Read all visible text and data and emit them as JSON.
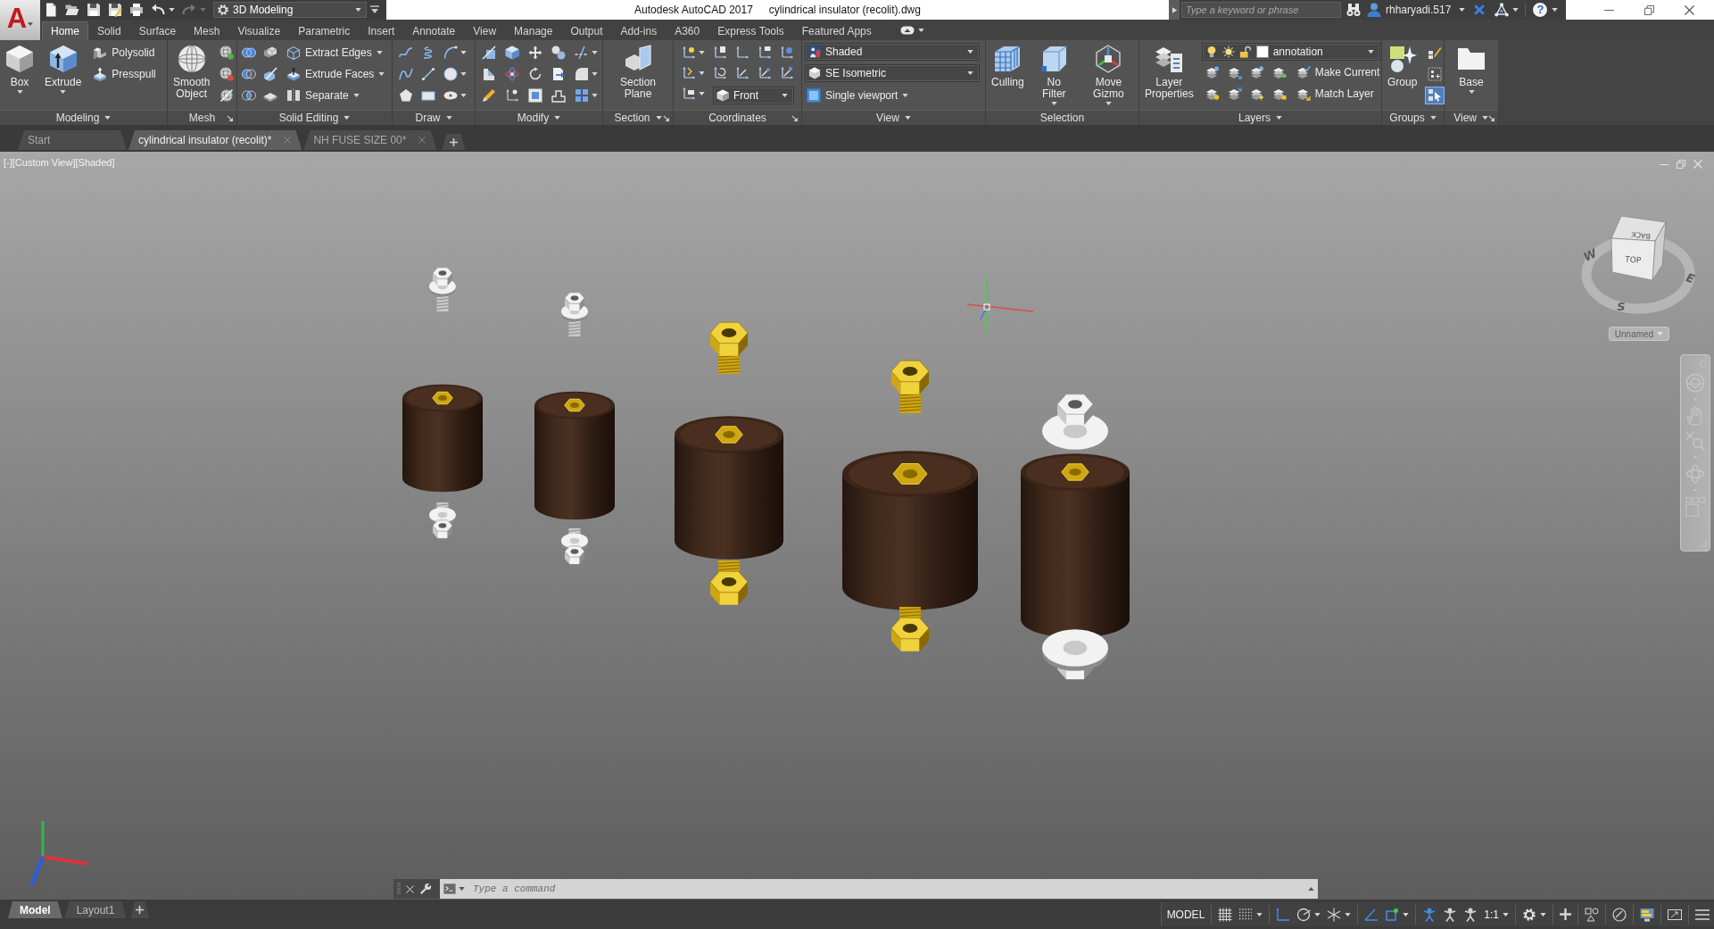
{
  "title_bar": {
    "app_logo": "A",
    "quick_access": [
      {
        "disabled": false
      },
      {
        "disabled": false
      },
      {
        "disabled": false
      },
      {
        "disabled": false
      },
      {
        "disabled": false
      },
      {
        "disabled": false
      },
      {
        "disabled": true
      }
    ],
    "workspace": "3D Modeling",
    "app_name": "Autodesk AutoCAD 2017",
    "file_name": "cylindrical insulator (recolit).dwg",
    "search": {
      "placeholder": "Type a keyword or phrase"
    },
    "user": "rhharyadi.517",
    "help": "?"
  },
  "ribbon_tabs": [
    {
      "label": "Home",
      "selected": true
    },
    {
      "label": "Solid",
      "selected": false
    },
    {
      "label": "Surface",
      "selected": false
    },
    {
      "label": "Mesh",
      "selected": false
    },
    {
      "label": "Visualize",
      "selected": false
    },
    {
      "label": "Parametric",
      "selected": false
    },
    {
      "label": "Insert",
      "selected": false
    },
    {
      "label": "Annotate",
      "selected": false
    },
    {
      "label": "View",
      "selected": false
    },
    {
      "label": "Manage",
      "selected": false
    },
    {
      "label": "Output",
      "selected": false
    },
    {
      "label": "Add-ins",
      "selected": false
    },
    {
      "label": "A360",
      "selected": false
    },
    {
      "label": "Express Tools",
      "selected": false
    },
    {
      "label": "Featured Apps",
      "selected": false
    }
  ],
  "ribbon_panels": [
    {
      "kind": "modeling",
      "title": "Modeling",
      "menu": true,
      "launcher": false,
      "large_buttons": [
        {
          "label": "Box",
          "dropdown": true
        },
        {
          "label": "Extrude",
          "dropdown": true
        }
      ],
      "small_buttons": [
        {
          "label": "Polysolid",
          "dropdown": false
        },
        {
          "label": "Presspull",
          "dropdown": false
        }
      ]
    },
    {
      "kind": "mesh",
      "title": "Mesh",
      "menu": false,
      "launcher": true,
      "large_buttons": [
        {
          "label": "Smooth Object",
          "dropdown": false
        }
      ]
    },
    {
      "kind": "solid_editing",
      "title": "Solid Editing",
      "menu": true,
      "launcher": false,
      "small_buttons": [
        {
          "label": "Extract Edges",
          "dropdown": true
        },
        {
          "label": "Extrude Faces",
          "dropdown": true
        },
        {
          "label": "Separate",
          "dropdown": true
        }
      ]
    },
    {
      "kind": "draw",
      "title": "Draw",
      "menu": true,
      "launcher": false
    },
    {
      "kind": "modify",
      "title": "Modify",
      "menu": true,
      "launcher": false
    },
    {
      "kind": "section",
      "title": "Section",
      "menu": true,
      "launcher": true,
      "large_buttons": [
        {
          "label": "Section Plane",
          "dropdown": false
        }
      ]
    },
    {
      "kind": "coordinates",
      "title": "Coordinates",
      "menu": false,
      "launcher": true,
      "dropdowns": [
        {
          "value": "Front"
        }
      ]
    },
    {
      "kind": "view",
      "title": "View",
      "menu": true,
      "launcher": false,
      "dropdowns": [
        {
          "value": "Shaded"
        },
        {
          "value": "SE Isometric"
        }
      ],
      "small_buttons": [
        {
          "label": "Single viewport",
          "dropdown": true
        }
      ]
    },
    {
      "kind": "selection",
      "title": "Selection",
      "menu": false,
      "launcher": false,
      "large_buttons": [
        {
          "label": "Culling",
          "dropdown": false
        },
        {
          "label": "No Filter",
          "dropdown": true
        },
        {
          "label": "Move Gizmo",
          "dropdown": true
        }
      ]
    },
    {
      "kind": "layers",
      "title": "Layers",
      "menu": true,
      "launcher": false,
      "large_buttons": [
        {
          "label": "Layer Properties",
          "dropdown": false
        }
      ],
      "dropdowns": [
        {
          "value": "annotation"
        }
      ],
      "small_buttons": [
        {
          "label": "Make Current",
          "dropdown": false
        },
        {
          "label": "Match Layer",
          "dropdown": false
        }
      ]
    },
    {
      "kind": "groups",
      "title": "Groups",
      "menu": true,
      "launcher": false,
      "large_buttons": [
        {
          "label": "Group",
          "dropdown": false
        }
      ],
      "toggles": [
        {
          "on": false
        },
        {
          "on": false
        },
        {
          "on": true
        }
      ]
    },
    {
      "kind": "view_base",
      "title": "View",
      "menu": true,
      "launcher": true,
      "large_buttons": [
        {
          "label": "Base",
          "dropdown": true
        }
      ]
    }
  ],
  "document_tabs": [
    {
      "label": "Start",
      "selected": false,
      "closable": false
    },
    {
      "label": "cylindrical insulator (recolit)*",
      "selected": true,
      "closable": true
    },
    {
      "label": "NH FUSE SIZE 00*",
      "selected": false,
      "closable": true
    }
  ],
  "viewport": {
    "label": "[-][Custom View][Shaded]",
    "viewcube": {
      "faces": [
        "TOP",
        "BACK"
      ],
      "compass": [
        "W",
        "E",
        "S"
      ],
      "view_name": "Unnamed"
    }
  },
  "command_line": {
    "placeholder": "Type a command"
  },
  "layout_tabs": [
    {
      "label": "Model",
      "selected": true
    },
    {
      "label": "Layout1",
      "selected": false
    }
  ],
  "status_bar": {
    "space": "MODEL",
    "toggles": [
      {
        "on": false
      },
      {
        "on": false
      },
      {
        "on": true
      },
      {
        "on": false
      },
      {
        "on": false
      },
      {
        "on": true
      },
      {
        "on": true
      },
      {
        "on": true
      },
      {
        "on": false
      }
    ],
    "annotation_scale": "1:1"
  }
}
